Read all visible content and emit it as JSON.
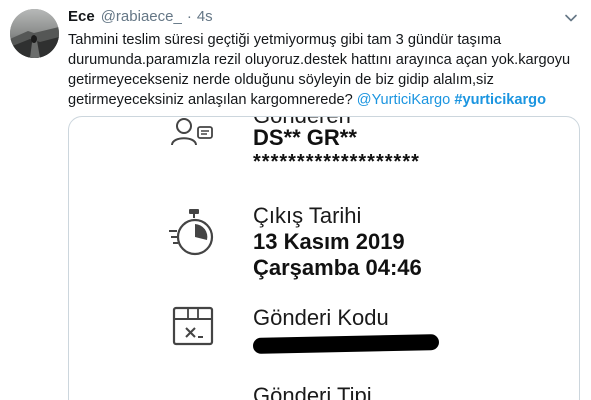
{
  "tweet": {
    "author_name": "Ece",
    "author_handle": "@rabiaece_",
    "separator": "·",
    "time": "4s",
    "text": {
      "line1": "Tahmini teslim süresi geçtiği yetmiyormuş gibi tam 3 gündür taşıma",
      "line2": "durumunda.paramızla rezil oluyoruz.destek hattını arayınca açan yok.kargoyu",
      "line3": "getirmeyecekseniz nerde olduğunu söyleyin de biz gidip alalım,siz",
      "line4_text": "getirmeyeceksiniz anlaşılan kargomnerede? ",
      "mention": "@YurticiKargo",
      "hashtag": "#yurticikargo"
    }
  },
  "media": {
    "sender_label": "Gönderen",
    "sender_name": "DS** GR**",
    "sender_masked": "*******************",
    "departure_label": "Çıkış Tarihi",
    "departure_date": "13 Kasım 2019",
    "departure_day_time": "Çarşamba 04:46",
    "shipment_code_label": "Gönderi Kodu",
    "shipment_type_label": "Gönderi Tipi"
  },
  "icons": {
    "caret": "chevron-down-icon",
    "sender": "person-card-icon",
    "departure": "stopwatch-icon",
    "code": "package-icon"
  },
  "colors": {
    "link": "#1b95e0",
    "secondary_text": "#657786",
    "border": "#ccd6dd"
  }
}
